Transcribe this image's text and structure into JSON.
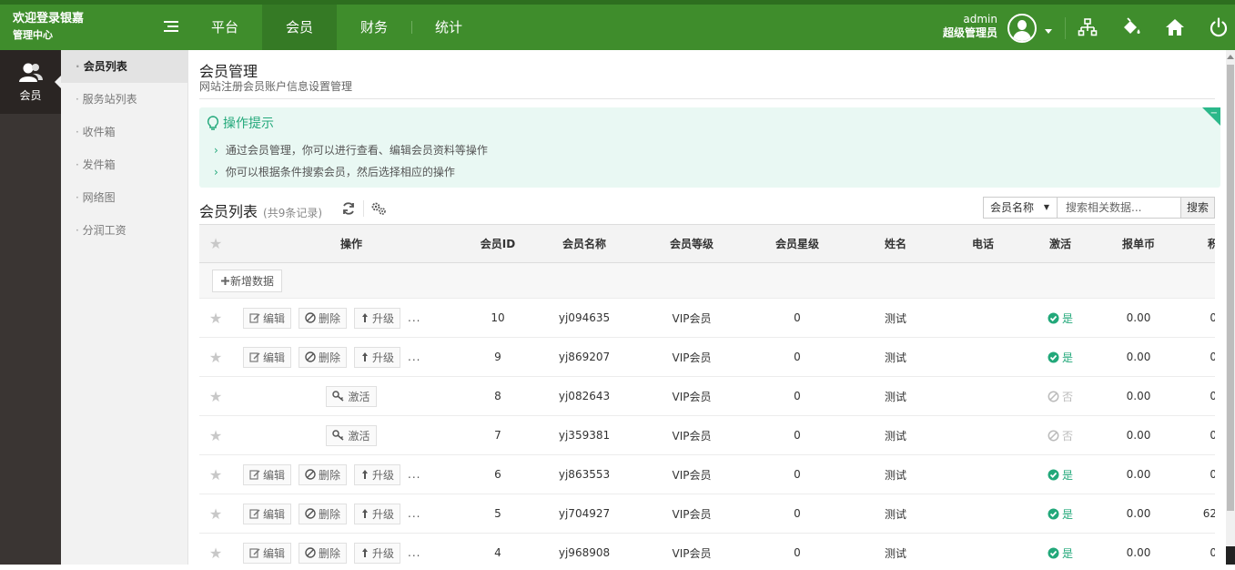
{
  "header": {
    "brand_line1": "欢迎登录银嘉",
    "brand_line2": "管理中心",
    "nav": [
      {
        "label": "平台",
        "active": false
      },
      {
        "label": "会员",
        "active": true
      },
      {
        "label": "财务",
        "active": false
      },
      {
        "label": "统计",
        "active": false
      }
    ],
    "username": "admin",
    "role": "超级管理员",
    "icons": [
      "sitemap-icon",
      "paint-bucket-icon",
      "home-icon",
      "power-icon"
    ]
  },
  "rail": {
    "label": "会员",
    "icon": "users-icon"
  },
  "sidebar": {
    "items": [
      {
        "label": "会员列表",
        "active": true
      },
      {
        "label": "服务站列表",
        "active": false
      },
      {
        "label": "收件箱",
        "active": false
      },
      {
        "label": "发件箱",
        "active": false
      },
      {
        "label": "网络图",
        "active": false
      },
      {
        "label": "分润工资",
        "active": false
      }
    ]
  },
  "page": {
    "title": "会员管理",
    "subtitle": "网站注册会员账户信息设置管理"
  },
  "tips": {
    "title": "操作提示",
    "items": [
      "通过会员管理，你可以进行查看、编辑会员资料等操作",
      "你可以根据条件搜索会员，然后选择相应的操作"
    ]
  },
  "list": {
    "title": "会员列表",
    "count": "(共9条记录)",
    "search_field": "会员名称",
    "search_placeholder": "搜索相关数据...",
    "search_button": "搜索",
    "add_label": "新增数据",
    "columns": [
      "操作",
      "会员ID",
      "会员名称",
      "会员等级",
      "会员星级",
      "姓名",
      "电话",
      "激活",
      "报单币",
      "积"
    ],
    "actions": {
      "edit": "编辑",
      "delete": "删除",
      "upgrade": "升级",
      "activate": "激活",
      "more": "..."
    },
    "rows": [
      {
        "id": "10",
        "name": "yj094635",
        "level": "VIP会员",
        "star": "0",
        "realname": "测试",
        "phone": "",
        "active": true,
        "active_text": "是",
        "coin": "0.00",
        "last": "0"
      },
      {
        "id": "9",
        "name": "yj869207",
        "level": "VIP会员",
        "star": "0",
        "realname": "测试",
        "phone": "",
        "active": true,
        "active_text": "是",
        "coin": "0.00",
        "last": "0"
      },
      {
        "id": "8",
        "name": "yj082643",
        "level": "VIP会员",
        "star": "0",
        "realname": "测试",
        "phone": "",
        "active": false,
        "active_text": "否",
        "coin": "0.00",
        "last": "0"
      },
      {
        "id": "7",
        "name": "yj359381",
        "level": "VIP会员",
        "star": "0",
        "realname": "测试",
        "phone": "",
        "active": false,
        "active_text": "否",
        "coin": "0.00",
        "last": "0"
      },
      {
        "id": "6",
        "name": "yj863553",
        "level": "VIP会员",
        "star": "0",
        "realname": "测试",
        "phone": "",
        "active": true,
        "active_text": "是",
        "coin": "0.00",
        "last": "0"
      },
      {
        "id": "5",
        "name": "yj704927",
        "level": "VIP会员",
        "star": "0",
        "realname": "测试",
        "phone": "",
        "active": true,
        "active_text": "是",
        "coin": "0.00",
        "last": "62"
      },
      {
        "id": "4",
        "name": "yj968908",
        "level": "VIP会员",
        "star": "0",
        "realname": "测试",
        "phone": "",
        "active": true,
        "active_text": "是",
        "coin": "0.00",
        "last": "0"
      }
    ]
  },
  "colors": {
    "brand_green": "#3f8d2c",
    "accent_teal": "#22a87a",
    "tips_bg": "#e9f8f3"
  }
}
